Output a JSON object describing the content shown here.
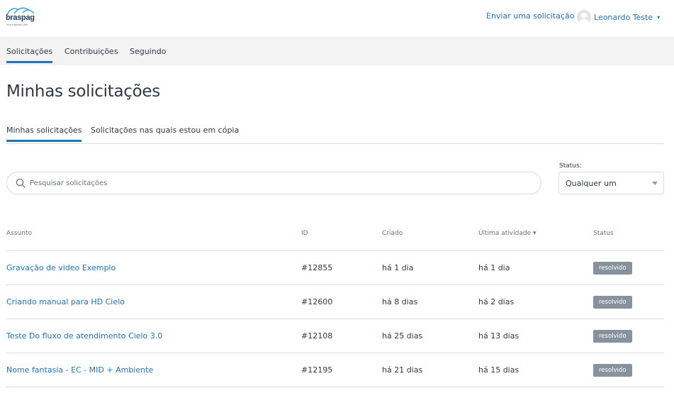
{
  "header": {
    "logo_text": "braspag",
    "logo_sub": "uma empresa Cielo",
    "submit_link": "Enviar uma solicitação",
    "user_name": "Leonardo Teste",
    "chevron": "⌄"
  },
  "nav": {
    "tabs": [
      {
        "label": "Solicitações",
        "active": true
      },
      {
        "label": "Contribuições",
        "active": false
      },
      {
        "label": "Seguindo",
        "active": false
      }
    ]
  },
  "page_title": "Minhas solicitações",
  "subtabs": [
    {
      "label": "Minhas solicitações",
      "active": true
    },
    {
      "label": "Solicitações nas quais estou em cópia",
      "active": false
    }
  ],
  "search": {
    "placeholder": "Pesquisar solicitações",
    "value": ""
  },
  "status_filter": {
    "label": "Status:",
    "selected": "Qualquer um"
  },
  "table": {
    "columns": [
      "Assunto",
      "ID",
      "Criado",
      "Última atividade ▾",
      "Status"
    ],
    "rows": [
      {
        "subject": "Gravação de video Exemplo",
        "id": "#12855",
        "created": "há 1 dia",
        "last_activity": "há 1 dia",
        "status": "resolvido"
      },
      {
        "subject": "Criando manual para HD Cielo",
        "id": "#12600",
        "created": "há 8 dias",
        "last_activity": "há 2 dias",
        "status": "resolvido"
      },
      {
        "subject": "Teste Do fluxo de atendimento Cielo 3.0",
        "id": "#12108",
        "created": "há 25 dias",
        "last_activity": "há 13 dias",
        "status": "resolvido"
      },
      {
        "subject": "Nome fantasia - EC - MID + Ambiente",
        "id": "#12195",
        "created": "há 21 dias",
        "last_activity": "há 15 dias",
        "status": "resolvido"
      }
    ]
  },
  "colors": {
    "accent": "#1f73b7",
    "badge": "#87929d",
    "nav_band": "#f3f3f3",
    "logo_arc": "#3fa9e0"
  },
  "icons": {
    "logo": "braspag-logo-icon",
    "avatar": "user-avatar-icon",
    "search": "search-icon",
    "dropdown": "caret-down-icon"
  }
}
